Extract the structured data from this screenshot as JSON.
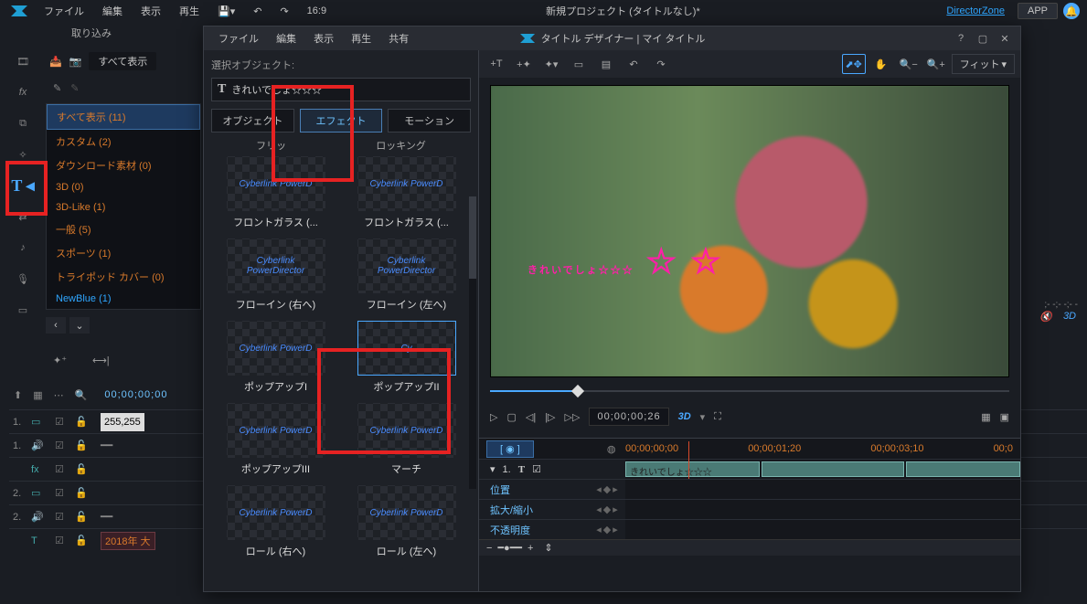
{
  "topMenu": {
    "file": "ファイル",
    "edit": "編集",
    "view": "表示",
    "play": "再生",
    "project": "新規プロジェクト (タイトルなし)*",
    "dz": "DirectorZone",
    "app": "APP",
    "aspect": "16:9"
  },
  "subRow": {
    "capture": "取り込み"
  },
  "mediaTop": {
    "showAll": "すべて表示"
  },
  "categories": [
    {
      "label": "すべて表示 (11)",
      "sel": true
    },
    {
      "label": "カスタム (2)"
    },
    {
      "label": "ダウンロード素材 (0)"
    },
    {
      "label": "3D (0)"
    },
    {
      "label": "3D-Like (1)"
    },
    {
      "label": "一般 (5)"
    },
    {
      "label": "スポーツ (1)"
    },
    {
      "label": "トライポッド カバー (0)"
    },
    {
      "label": "NewBlue (1)",
      "cls": "newblue"
    }
  ],
  "timelineHead": {
    "tc": "00;00;00;00"
  },
  "timelineRows": [
    {
      "num": "1.",
      "kind": "video",
      "clip": "255,255"
    },
    {
      "num": "1.",
      "kind": "audio"
    },
    {
      "num": "",
      "kind": "fx"
    },
    {
      "num": "2.",
      "kind": "video"
    },
    {
      "num": "2.",
      "kind": "audio"
    },
    {
      "num": "",
      "kind": "title",
      "tclip": "2018年 大"
    }
  ],
  "dialog": {
    "menu": {
      "file": "ファイル",
      "edit": "編集",
      "view": "表示",
      "play": "再生",
      "share": "共有"
    },
    "title": "タイトル デザイナー | マイ タイトル",
    "selObj": "選択オブジェクト:",
    "titleText": "きれいでしょ☆☆☆",
    "tabs": {
      "obj": "オブジェクト",
      "effect": "エフェクト",
      "motion": "モーション"
    },
    "subLabels": {
      "l": "フリッ",
      "r": "ロッキング"
    },
    "thumbs": [
      {
        "txt": "Cyberlink PowerD",
        "label": "フロントガラス (..."
      },
      {
        "txt": "Cyberlink PowerD",
        "label": "フロントガラス (..."
      },
      {
        "txt": "Cyberlink PowerDirector",
        "label": "フローイン (右へ)"
      },
      {
        "txt": "Cyberlink PowerDirector",
        "label": "フローイン (左へ)"
      },
      {
        "txt": "Cyberlink PowerD",
        "label": "ポップアップI"
      },
      {
        "txt": "Cy",
        "label": "ポップアップII",
        "sel": true
      },
      {
        "txt": "Cyberlink PowerD",
        "label": "ポップアップIII"
      },
      {
        "txt": "Cyberlink PowerD",
        "label": "マーチ"
      },
      {
        "txt": "Cyberlink PowerD",
        "label": "ロール (右へ)"
      },
      {
        "txt": "Cyberlink PowerD",
        "label": "ロール (左へ)"
      }
    ],
    "fit": "フィット",
    "transport": {
      "tc": "00;00;00;26",
      "threeD": "3D"
    },
    "ruler": {
      "mode": "◉",
      "ticks": [
        "00;00;00;00",
        "00;00;01;20",
        "00;00;03;10",
        "00;0"
      ]
    },
    "kfRows": [
      {
        "label": "位置"
      },
      {
        "label": "拡大/縮小"
      },
      {
        "label": "不透明度"
      }
    ],
    "titleTrack": {
      "num": "1.",
      "text": "きれいでしょ☆☆☆"
    }
  },
  "corner": {
    "tc": ";- -;- -;- -",
    "threeD": "3D"
  }
}
